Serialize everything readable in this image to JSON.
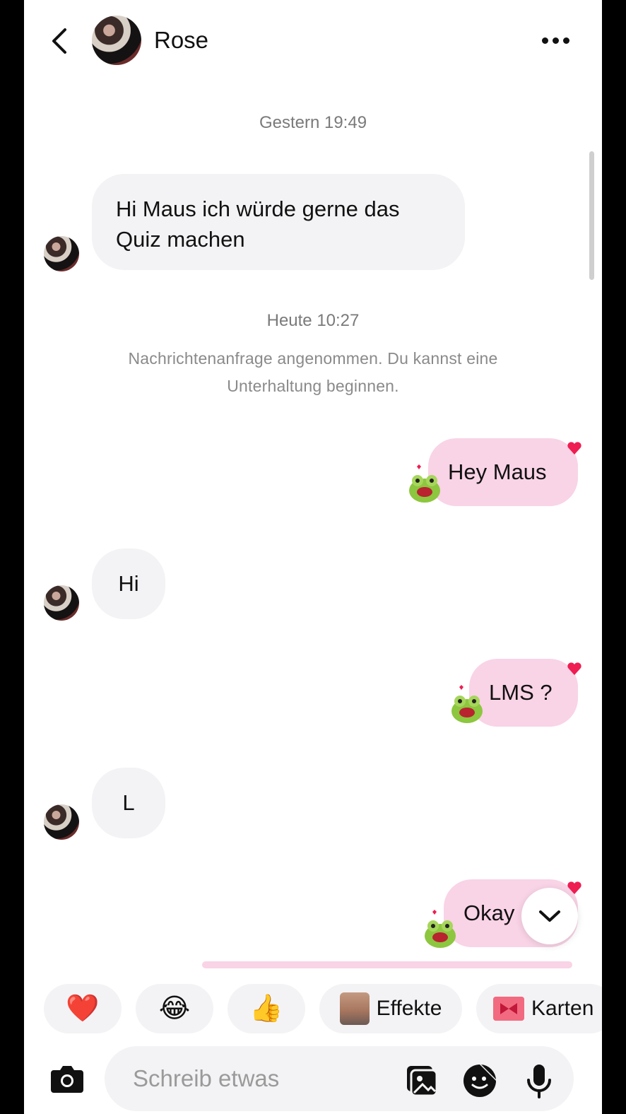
{
  "header": {
    "contact_name": "Rose",
    "icons": {
      "back": "chevron-left-icon",
      "more": "more-horizontal-icon"
    }
  },
  "conversation": {
    "timestamp_1": "Gestern 19:49",
    "msg_1_line_1": "Hi Maus ich würde gerne das",
    "msg_1_line_2": "Quiz machen",
    "timestamp_2": "Heute 10:27",
    "system_note_line_1": "Nachrichtenanfrage angenommen. Du kannst eine",
    "system_note_line_2": "Unterhaltung beginnen.",
    "msg_2": "Hey Maus",
    "msg_3": "Hi",
    "msg_4": "LMS ?",
    "msg_5": "L",
    "msg_6": "Okay"
  },
  "reactions": {
    "heart": "❤️",
    "laugh": "😂",
    "thumbs_up": "👍",
    "effects_label": "Effekte",
    "cards_label": "Karten"
  },
  "composer": {
    "placeholder": "Schreib etwas",
    "icons": [
      "camera-icon",
      "image-icon",
      "sticker-icon",
      "microphone-icon"
    ]
  },
  "colors": {
    "outgoing_bubble": "#f9d3e6",
    "incoming_bubble": "#f3f3f5",
    "heart_badge": "#ee1d52"
  }
}
